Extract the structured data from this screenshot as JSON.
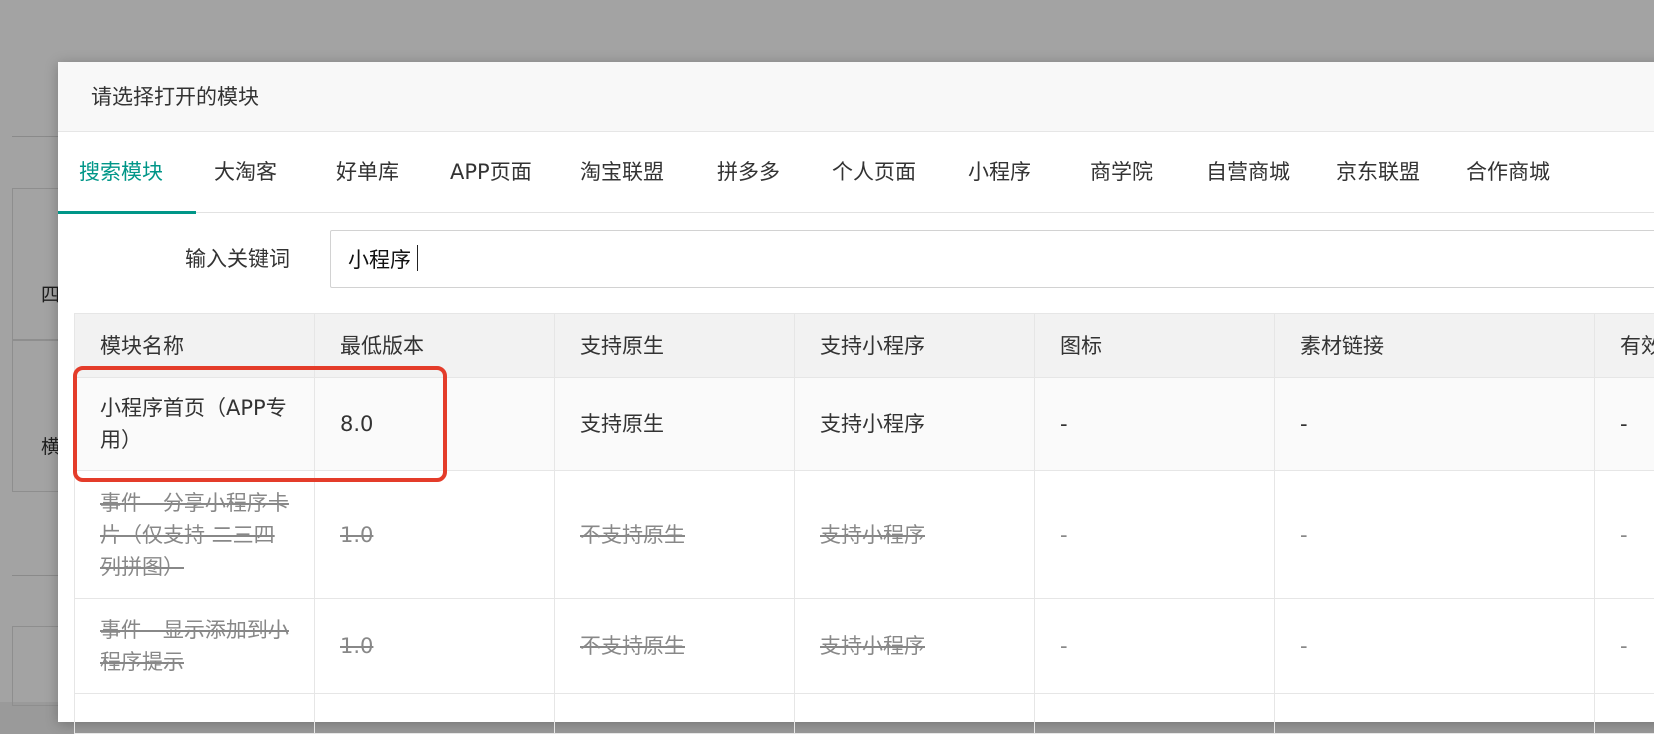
{
  "background": {
    "side_chars": [
      "四",
      "横"
    ]
  },
  "modal": {
    "title": "请选择打开的模块",
    "tabs": [
      {
        "label": "搜索模块",
        "active": true
      },
      {
        "label": "大淘客"
      },
      {
        "label": "好单库"
      },
      {
        "label": "APP页面"
      },
      {
        "label": "淘宝联盟"
      },
      {
        "label": "拼多多"
      },
      {
        "label": "个人页面"
      },
      {
        "label": "小程序"
      },
      {
        "label": "商学院"
      },
      {
        "label": "自营商城"
      },
      {
        "label": "京东联盟"
      },
      {
        "label": "合作商城"
      }
    ],
    "search": {
      "label": "输入关键词",
      "value": "小程序"
    },
    "table": {
      "headers": [
        "模块名称",
        "最低版本",
        "支持原生",
        "支持小程序",
        "图标",
        "素材链接",
        "有效"
      ],
      "rows": [
        {
          "name": "小程序首页（APP专用）",
          "min_version": "8.0",
          "native": "支持原生",
          "miniprogram": "支持小程序",
          "icon": "-",
          "material": "-",
          "valid": "-",
          "disabled": false
        },
        {
          "name": "事件 - 分享小程序卡片（仅支持 二三四列拼图）",
          "min_version": "1.0",
          "native": "不支持原生",
          "miniprogram": "支持小程序",
          "icon": "-",
          "material": "-",
          "valid": "-",
          "disabled": true
        },
        {
          "name": "事件 - 显示添加到小程序提示",
          "min_version": "1.0",
          "native": "不支持原生",
          "miniprogram": "支持小程序",
          "icon": "-",
          "material": "-",
          "valid": "-",
          "disabled": true
        }
      ]
    }
  },
  "colors": {
    "accent": "#009688",
    "highlight_border": "#e43c2a",
    "overlay": "#a3a3a3"
  }
}
